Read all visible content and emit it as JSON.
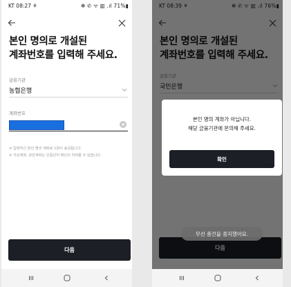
{
  "screens": [
    {
      "status": {
        "left": "KT 08:27 ⚘",
        "right": "✻ ✆ ᯤ ▥ .ıl 71%▮"
      },
      "title": [
        "본인 명의로 개설된",
        "계좌번호를 입력해 주세요."
      ],
      "bank_label": "금융기관",
      "bank_value": "농협은행",
      "account_label": "계좌번호",
      "account_value": "",
      "notes": [
        "※ 입력하신 본인 명의 계좌로 1원이 송금됩니다.",
        "※ 가상계좌, 보안계좌는 인증단어 확인이 어려울 수 있습니다."
      ],
      "next_label": "다음"
    },
    {
      "status": {
        "left": "KT 08:39 ⚘",
        "right": "✻ ✆ ᯤ ▥ .ıl 76%▮"
      },
      "title": [
        "본인 명의로 개설된",
        "계좌번호를 입력해 주세요."
      ],
      "bank_label": "금융기관",
      "bank_value": "국민은행",
      "next_label": "다음",
      "dialog": {
        "message": [
          "본인 명의 계좌가 아닙니다.",
          "해당 금융기관에 문의해 주세요."
        ],
        "confirm_label": "확인"
      },
      "toast": "무선 충전을 중지했어요."
    }
  ],
  "colors": {
    "primary_button": "#1c1f26",
    "selection": "#1a6fe0",
    "overlay": "#000000"
  },
  "icons": [
    "back-arrow-icon",
    "close-icon",
    "chevron-down-icon",
    "clear-icon",
    "recent-apps-icon",
    "home-icon",
    "back-nav-icon"
  ]
}
